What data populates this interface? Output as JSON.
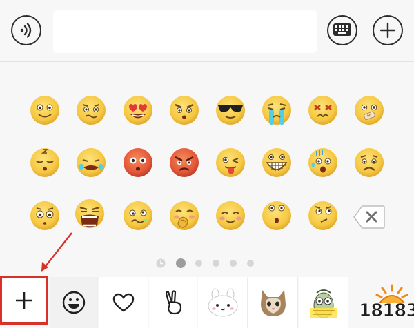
{
  "input_bar": {
    "voice_icon": "voice-wave-icon",
    "keyboard_icon": "keyboard-icon",
    "add_icon": "plus-circle-icon",
    "text_value": ""
  },
  "emoji_panel": {
    "rows": [
      [
        "smile",
        "awkward-smile",
        "heart-eyes",
        "angry-frown",
        "cool-sunglasses",
        "crying",
        "dizzy",
        "bandaged"
      ],
      [
        "sleepy",
        "tearful",
        "shocked-red",
        "furious-red",
        "tongue-wink",
        "big-grin",
        "scared-sweat",
        "sad"
      ],
      [
        "wide-eyed",
        "bawling",
        "drunk",
        "facepalm-blush",
        "blushing-smile",
        "surprised",
        "thinking",
        "backspace"
      ]
    ],
    "pages": 6,
    "current_page": 2
  },
  "tabs": [
    {
      "name": "add-sticker",
      "icon": "plus-icon"
    },
    {
      "name": "emoji",
      "icon": "smiley-icon"
    },
    {
      "name": "favorites",
      "icon": "heart-icon"
    },
    {
      "name": "gesture",
      "icon": "victory-hand-icon"
    },
    {
      "name": "bunny-sticker",
      "icon": "bunny-face-icon"
    },
    {
      "name": "cat-sticker",
      "icon": "cat-photo-icon"
    },
    {
      "name": "cartoon-sticker",
      "icon": "cartoon-character-icon"
    }
  ],
  "watermark": {
    "text": "18183"
  },
  "colors": {
    "highlight": "#d9302a",
    "emoji_yellow": "#f5c842",
    "emoji_red": "#e8583a"
  }
}
